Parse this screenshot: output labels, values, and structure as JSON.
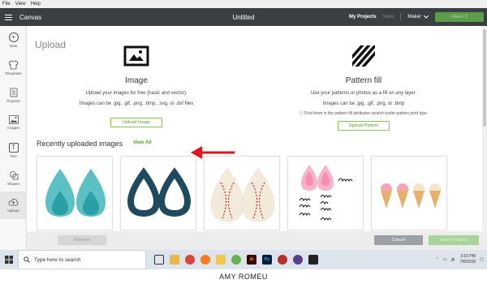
{
  "os_menu": [
    "File",
    "View",
    "Help"
  ],
  "header": {
    "app_name": "Canvas",
    "doc_title": "Untitled",
    "my_projects": "My Projects",
    "save": "Save",
    "maker": "Maker",
    "make_it": "Make It"
  },
  "sidebar": {
    "items": [
      {
        "label": "New",
        "icon": "plus-icon"
      },
      {
        "label": "Templates",
        "icon": "shirt-icon"
      },
      {
        "label": "Projects",
        "icon": "projects-icon"
      },
      {
        "label": "Images",
        "icon": "image-icon"
      },
      {
        "label": "Text",
        "icon": "text-icon"
      },
      {
        "label": "Shapes",
        "icon": "shapes-icon"
      },
      {
        "label": "Upload",
        "icon": "upload-icon"
      }
    ],
    "active_index": 6
  },
  "main": {
    "title": "Upload",
    "image_col": {
      "heading": "Image",
      "description": "Upload your images for free (basic and vector).",
      "formats": "Images can be .jpg, .gif, .png, .bmp, .svg, or .dxf files",
      "button": "Upload Image"
    },
    "pattern_col": {
      "heading": "Pattern fill",
      "description": "Use your patterns or photos as a fill on any layer.",
      "formats": "Images can be .jpg, .gif, .png, or .bmp",
      "hint": "Find them in the pattern fill attributes swatch under pattern print type.",
      "button": "Upload Pattern"
    },
    "recent": {
      "title": "Recently uploaded images",
      "view_all": "View All"
    }
  },
  "action_bar": {
    "remove": "Remove",
    "cancel": "Cancel",
    "insert": "Insert Images"
  },
  "taskbar": {
    "search_placeholder": "Type here to search",
    "time": "3:10 PM",
    "date": "7/8/2020"
  },
  "caption": "AMY ROMEU",
  "colors": {
    "header_bg": "#3a3f44",
    "accent_green": "#5c9e2e",
    "arrow_red": "#e0161b"
  }
}
